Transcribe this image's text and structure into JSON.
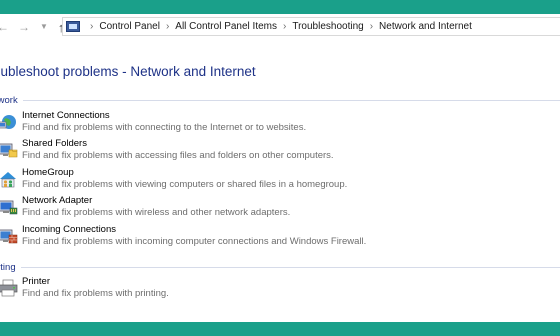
{
  "nav": {
    "back_glyph": "←",
    "forward_glyph": "→",
    "recent_glyph": "▼",
    "up_glyph": "↑"
  },
  "breadcrumb": {
    "icon": "control-panel-icon",
    "items": [
      "Control Panel",
      "All Control Panel Items",
      "Troubleshooting",
      "Network and Internet"
    ],
    "separator": "›"
  },
  "page": {
    "title": "oubleshoot problems - Network and Internet"
  },
  "groups": [
    {
      "label": "twork",
      "items": [
        {
          "title": "Internet Connections",
          "description": "Find and fix problems with connecting to the Internet or to websites.",
          "icon": "internet-connections-icon"
        },
        {
          "title": "Shared Folders",
          "description": "Find and fix problems with accessing files and folders on other computers.",
          "icon": "shared-folders-icon"
        },
        {
          "title": "HomeGroup",
          "description": "Find and fix problems with viewing computers or shared files in a homegroup.",
          "icon": "homegroup-icon"
        },
        {
          "title": "Network Adapter",
          "description": "Find and fix problems with wireless and other network adapters.",
          "icon": "network-adapter-icon"
        },
        {
          "title": "Incoming Connections",
          "description": "Find and fix problems with incoming computer connections and Windows Firewall.",
          "icon": "incoming-connections-icon"
        }
      ]
    },
    {
      "label": "nting",
      "items": [
        {
          "title": "Printer",
          "description": "Find and fix problems with printing.",
          "icon": "printer-icon"
        }
      ]
    }
  ],
  "colors": {
    "background_frame": "#1aa08a",
    "heading_blue": "#1e3287",
    "description_gray": "#6d6d6d"
  }
}
